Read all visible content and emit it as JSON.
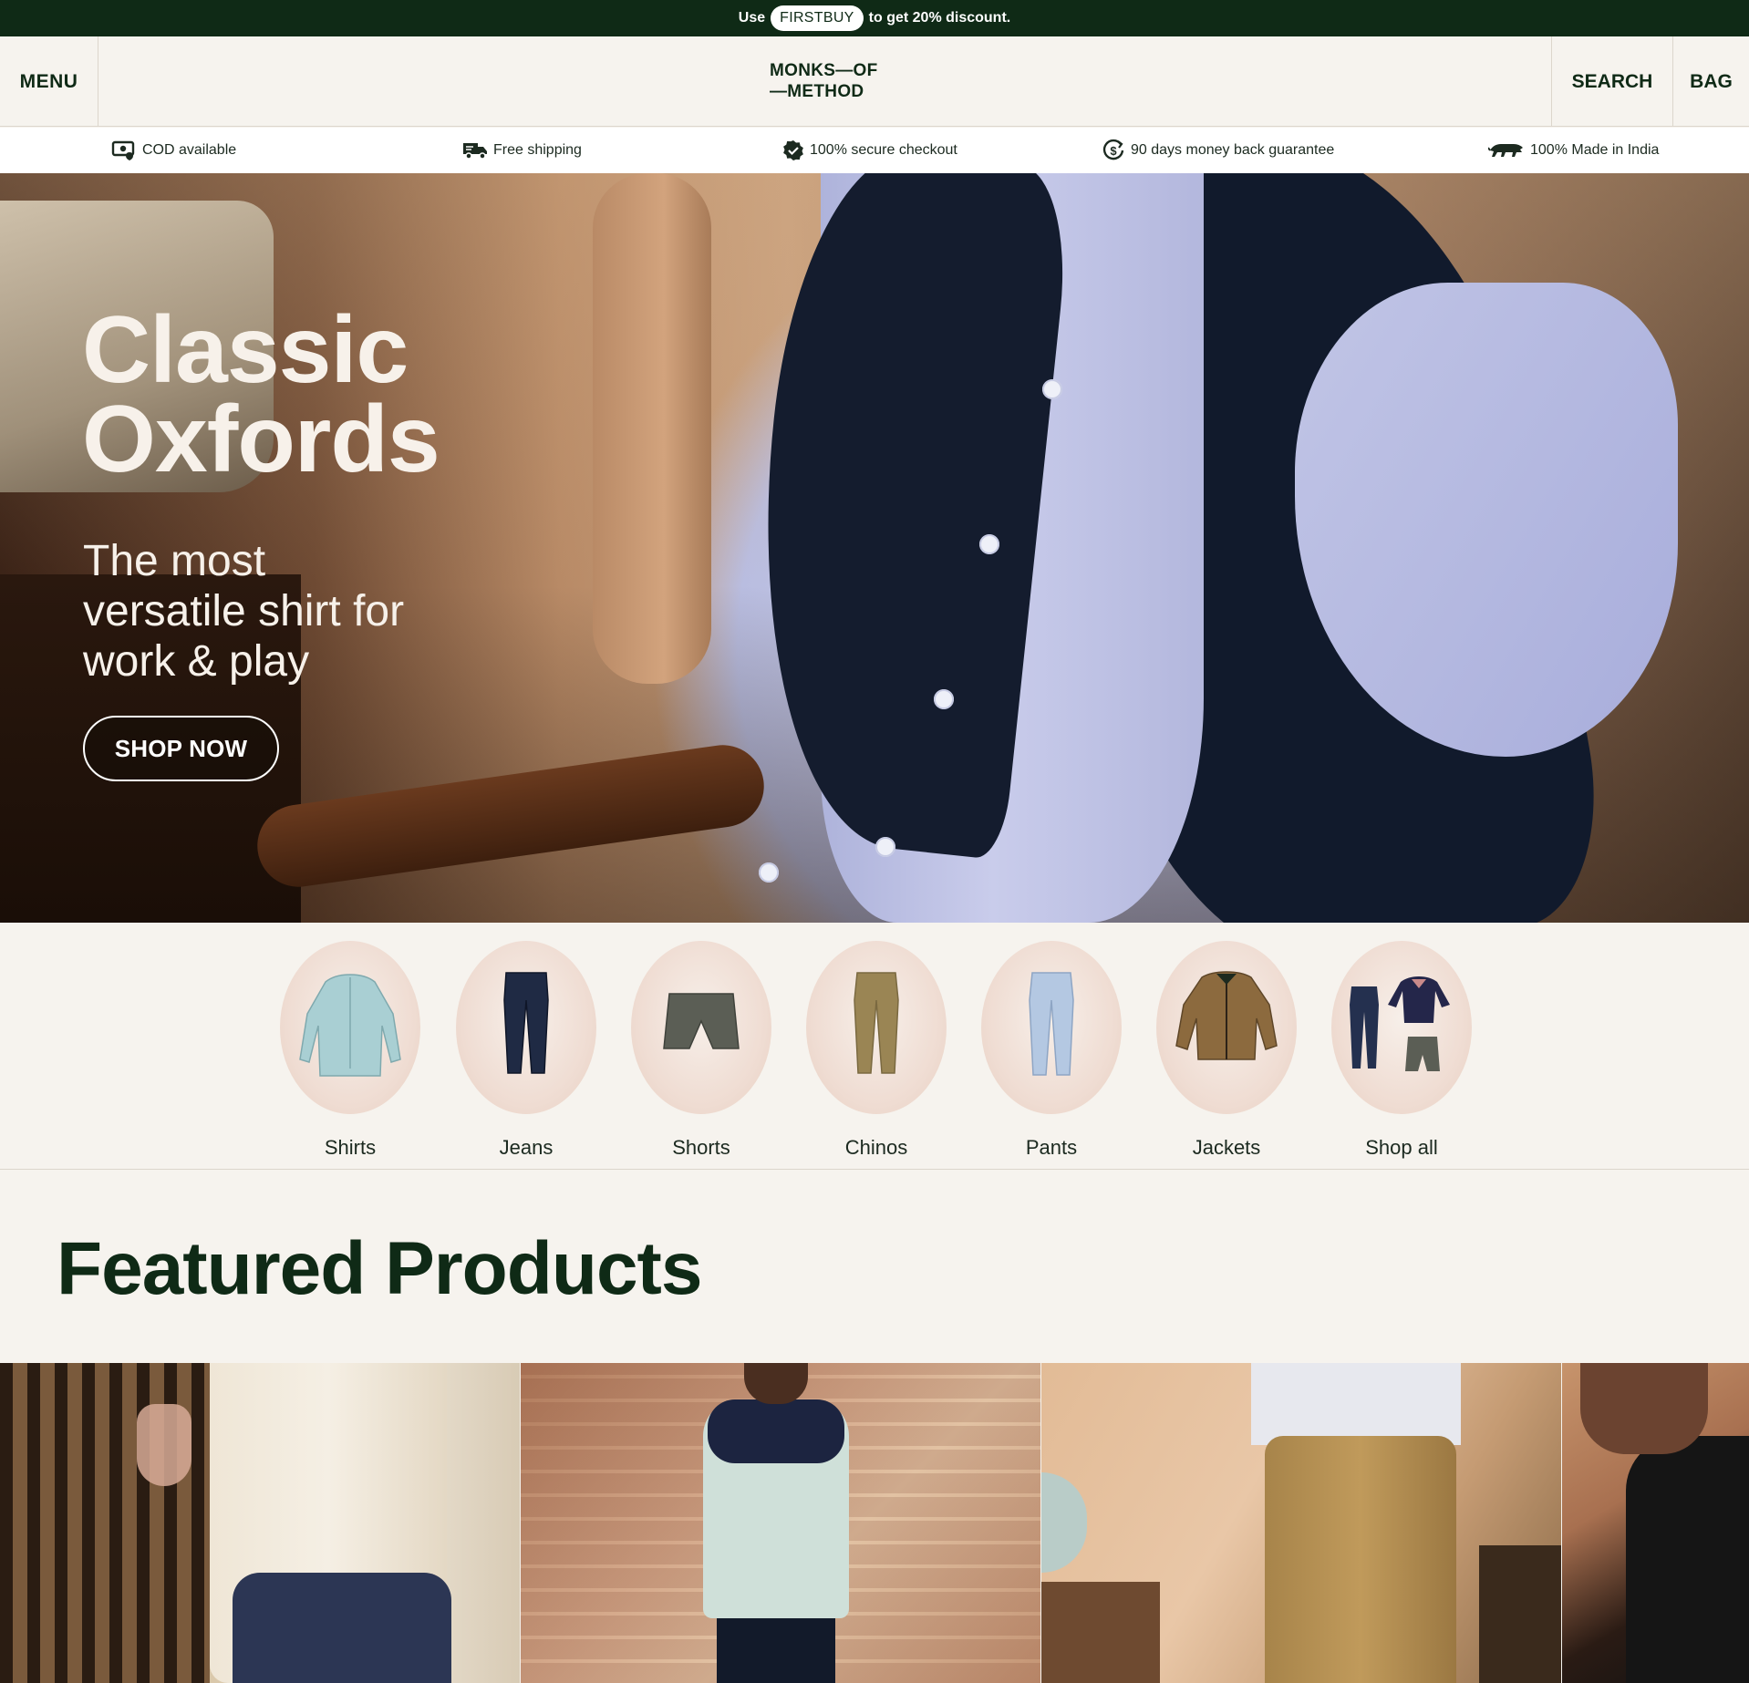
{
  "promo": {
    "prefix": "Use",
    "code": "FIRSTBUY",
    "suffix": "to get 20% discount."
  },
  "header": {
    "menu_label": "MENU",
    "logo_line1": "MONKS—OF",
    "logo_line2": "—METHOD",
    "search_label": "SEARCH",
    "bag_label": "BAG"
  },
  "usp": [
    {
      "icon": "cash-icon",
      "label": "COD available"
    },
    {
      "icon": "truck-icon",
      "label": "Free shipping"
    },
    {
      "icon": "verified-check-icon",
      "label": "100% secure checkout"
    },
    {
      "icon": "money-back-icon",
      "label": "90 days money back guarantee"
    },
    {
      "icon": "lion-icon",
      "label": "100% Made in India"
    }
  ],
  "hero": {
    "title_line1": "Classic",
    "title_line2": "Oxfords",
    "subtitle": "The most versatile shirt for work & play",
    "cta_label": "SHOP NOW"
  },
  "categories": [
    {
      "label": "Shirts",
      "icon": "shirt-thumb"
    },
    {
      "label": "Jeans",
      "icon": "jeans-thumb"
    },
    {
      "label": "Shorts",
      "icon": "shorts-thumb"
    },
    {
      "label": "Chinos",
      "icon": "chinos-thumb"
    },
    {
      "label": "Pants",
      "icon": "pants-thumb"
    },
    {
      "label": "Jackets",
      "icon": "jacket-thumb"
    },
    {
      "label": "Shop all",
      "icon": "shop-all-thumb"
    }
  ],
  "featured": {
    "heading": "Featured Products"
  },
  "colors": {
    "brand_green": "#0f2a16",
    "background": "#f6f3ee",
    "hero_text": "#f7f1ea"
  }
}
